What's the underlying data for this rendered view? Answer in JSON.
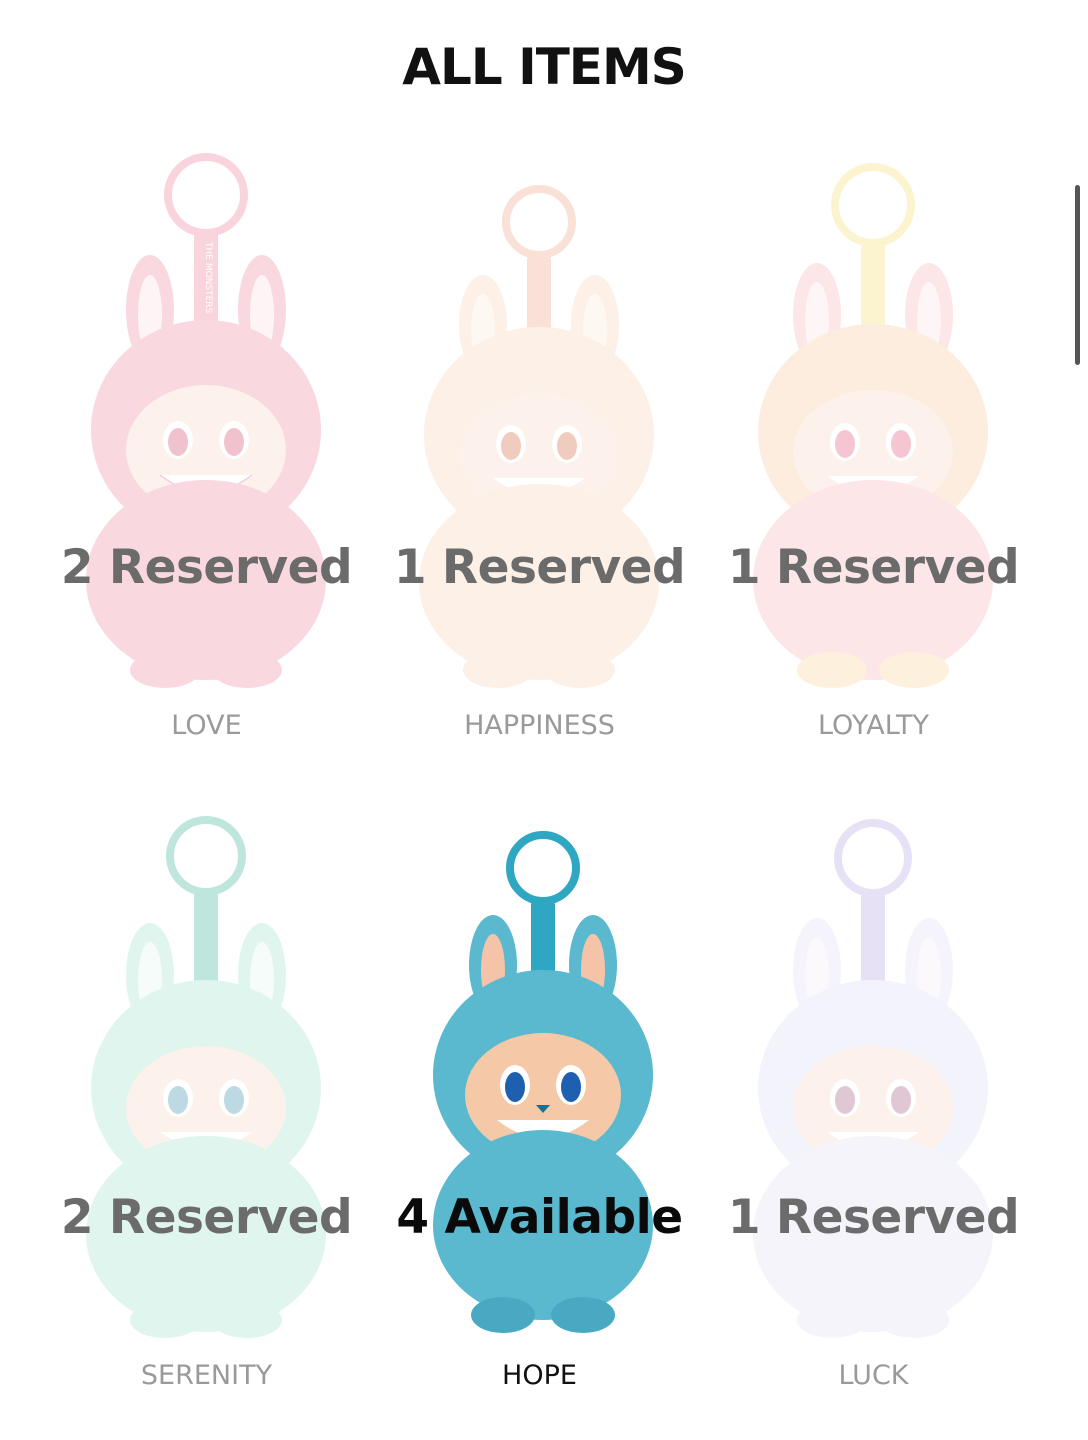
{
  "header": {
    "title": "ALL ITEMS"
  },
  "items": [
    {
      "name": "LOVE",
      "status": "2 Reserved",
      "state": "reserved",
      "color": "#f28aa3",
      "ring": "#f07f97"
    },
    {
      "name": "HAPPINESS",
      "status": "1 Reserved",
      "state": "reserved",
      "color": "#f6d3b8",
      "ring": "#f0a68a"
    },
    {
      "name": "LOYALTY",
      "status": "1 Reserved",
      "state": "reserved",
      "color": "#f7b6b8",
      "ring": "#f5e070"
    },
    {
      "name": "SERENITY",
      "status": "2 Reserved",
      "state": "reserved",
      "color": "#9fe2cd",
      "ring": "#3fb49b"
    },
    {
      "name": "HOPE",
      "status": "4 Available",
      "state": "available",
      "color": "#5ab9cf",
      "ring": "#2fa7c2"
    },
    {
      "name": "LUCK",
      "status": "1 Reserved",
      "state": "reserved",
      "color": "#dcdcf6",
      "ring": "#b7a7e3"
    }
  ],
  "strap_text": "THE MONSTERS",
  "icons": {
    "scrollbar": "scrollbar-thumb"
  }
}
